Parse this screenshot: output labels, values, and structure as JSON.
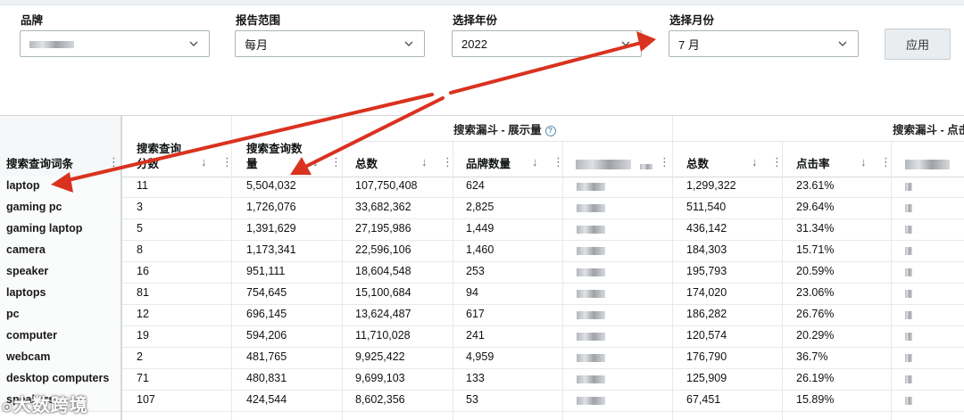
{
  "filters": {
    "brand": {
      "label": "品牌",
      "value": ""
    },
    "report_range": {
      "label": "报告范围",
      "value": "每月"
    },
    "year": {
      "label": "选择年份",
      "value": "2022"
    },
    "month": {
      "label": "选择月份",
      "value": "7 月"
    },
    "apply_label": "应用"
  },
  "table": {
    "group_headers": {
      "impressions": "搜索漏斗 - 展示量",
      "clicks": "搜索漏斗 - 点击"
    },
    "columns": {
      "keyword": "搜索查询词条",
      "score": "搜索查询分数",
      "volume": "搜索查询数量",
      "imp_total": "总数",
      "imp_brand": "品牌数量",
      "clk_total": "总数",
      "ctr": "点击率"
    },
    "rows": [
      {
        "keyword": "laptop",
        "score": "11",
        "volume": "5,504,032",
        "imp_total": "107,750,408",
        "imp_brand": "624",
        "clk_total": "1,299,322",
        "ctr": "23.61%"
      },
      {
        "keyword": "gaming pc",
        "score": "3",
        "volume": "1,726,076",
        "imp_total": "33,682,362",
        "imp_brand": "2,825",
        "clk_total": "511,540",
        "ctr": "29.64%"
      },
      {
        "keyword": "gaming laptop",
        "score": "5",
        "volume": "1,391,629",
        "imp_total": "27,195,986",
        "imp_brand": "1,449",
        "clk_total": "436,142",
        "ctr": "31.34%"
      },
      {
        "keyword": "camera",
        "score": "8",
        "volume": "1,173,341",
        "imp_total": "22,596,106",
        "imp_brand": "1,460",
        "clk_total": "184,303",
        "ctr": "15.71%"
      },
      {
        "keyword": "speaker",
        "score": "16",
        "volume": "951,111",
        "imp_total": "18,604,548",
        "imp_brand": "253",
        "clk_total": "195,793",
        "ctr": "20.59%"
      },
      {
        "keyword": "laptops",
        "score": "81",
        "volume": "754,645",
        "imp_total": "15,100,684",
        "imp_brand": "94",
        "clk_total": "174,020",
        "ctr": "23.06%"
      },
      {
        "keyword": "pc",
        "score": "12",
        "volume": "696,145",
        "imp_total": "13,624,487",
        "imp_brand": "617",
        "clk_total": "186,282",
        "ctr": "26.76%"
      },
      {
        "keyword": "computer",
        "score": "19",
        "volume": "594,206",
        "imp_total": "11,710,028",
        "imp_brand": "241",
        "clk_total": "120,574",
        "ctr": "20.29%"
      },
      {
        "keyword": "webcam",
        "score": "2",
        "volume": "481,765",
        "imp_total": "9,925,422",
        "imp_brand": "4,959",
        "clk_total": "176,790",
        "ctr": "36.7%"
      },
      {
        "keyword": "desktop computers",
        "score": "71",
        "volume": "480,831",
        "imp_total": "9,699,103",
        "imp_brand": "133",
        "clk_total": "125,909",
        "ctr": "26.19%"
      },
      {
        "keyword": "speakers",
        "score": "107",
        "volume": "424,544",
        "imp_total": "8,602,356",
        "imp_brand": "53",
        "clk_total": "67,451",
        "ctr": "15.89%"
      }
    ]
  },
  "watermark": "大数跨境",
  "colors": {
    "arrow": "#d9321f",
    "header_bg": "#f5f6f7",
    "border": "#d5d9dc"
  }
}
